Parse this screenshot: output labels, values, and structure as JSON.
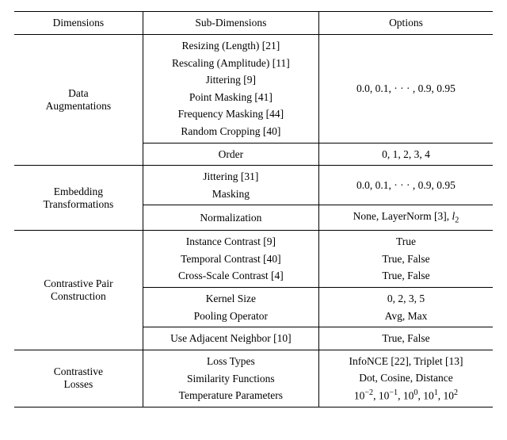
{
  "headers": {
    "dimensions": "Dimensions",
    "sub": "Sub-Dimensions",
    "options": "Options"
  },
  "rows": {
    "data_aug": {
      "label": "Data\nAugmentations",
      "sub1": "Resizing (Length) [21]\nRescaling (Amplitude) [11]\nJittering [9]\nPoint Masking [41]\nFrequency Masking [44]\nRandom Cropping [40]",
      "opt1": "0.0, 0.1, · · · , 0.9, 0.95",
      "sub2": "Order",
      "opt2": "0, 1, 2, 3, 4"
    },
    "embed": {
      "label": "Embedding\nTransformations",
      "sub1": "Jittering [31]\nMasking",
      "opt1": "0.0, 0.1, · · · , 0.9, 0.95",
      "sub2": "Normalization",
      "opt2_html": "None, LayerNorm [3], <i>l</i><sub>2</sub>"
    },
    "pair": {
      "label": "Contrastive Pair\nConstruction",
      "sub1": "Instance Contrast [9]\nTemporal Contrast [40]\nCross-Scale Contrast [4]",
      "opt1": "True\nTrue, False\nTrue, False",
      "sub2": "Kernel Size\nPooling Operator",
      "opt2": "0, 2, 3, 5\nAvg, Max",
      "sub3": "Use Adjacent Neighbor [10]",
      "opt3": "True, False"
    },
    "loss": {
      "label": "Contrastive\nLosses",
      "sub1": "Loss Types\nSimilarity Functions\nTemperature Parameters",
      "opt1_html": "InfoNCE [22], Triplet [13]<br>Dot, Cosine, Distance<br>10<sup>−2</sup>, 10<sup>−1</sup>, 10<sup>0</sup>, 10<sup>1</sup>, 10<sup>2</sup>"
    }
  }
}
